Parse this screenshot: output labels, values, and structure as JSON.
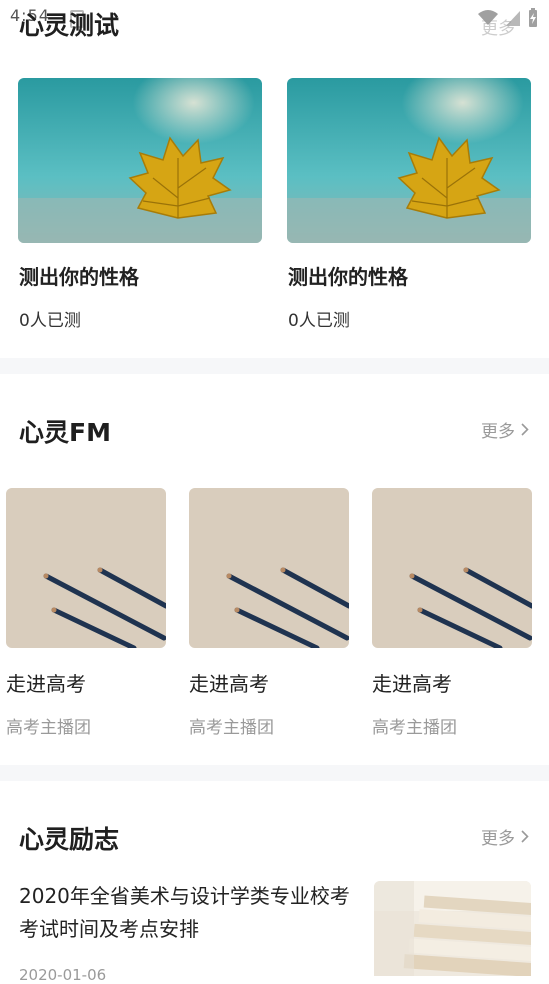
{
  "status_bar": {
    "time": "4:54"
  },
  "sections": {
    "test": {
      "title": "心灵测试",
      "more": "更多",
      "cards": [
        {
          "title": "测出你的性格",
          "count": "0人已测"
        },
        {
          "title": "测出你的性格",
          "count": "0人已测"
        }
      ]
    },
    "fm": {
      "title": "心灵FM",
      "more": "更多",
      "cards": [
        {
          "title": "走进高考",
          "subtitle": "高考主播团"
        },
        {
          "title": "走进高考",
          "subtitle": "高考主播团"
        },
        {
          "title": "走进高考",
          "subtitle": "高考主播团"
        }
      ]
    },
    "inspire": {
      "title": "心灵励志",
      "more": "更多",
      "article": {
        "title": "2020年全省美术与设计学类专业校考考试时间及考点安排",
        "date": "2020-01-06"
      }
    }
  },
  "icons": {
    "wifi": "wifi-icon",
    "signal": "signal-icon",
    "battery": "battery-icon",
    "chevron": "chevron-right-icon",
    "leaf": "leaf-image",
    "pencils": "pencils-image",
    "books": "books-image"
  }
}
